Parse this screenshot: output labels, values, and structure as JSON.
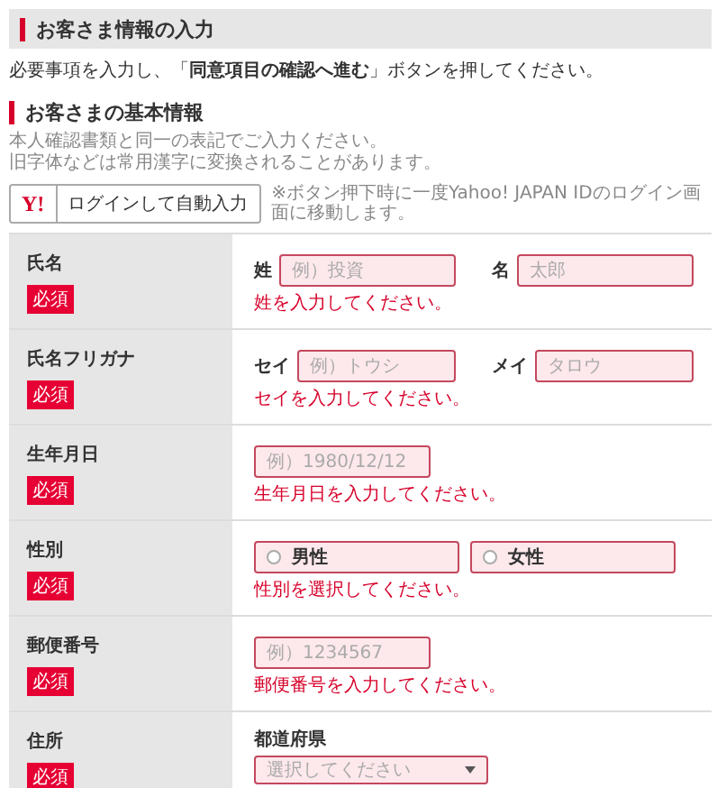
{
  "header": {
    "title": "お客さま情報の入力"
  },
  "intro": "必要事項を入力し、「**同意項目の確認へ進む**」ボタンを押してください。",
  "section": {
    "title": "お客さまの基本情報",
    "notes": [
      "本人確認書類と同一の表記でご入力ください。",
      "旧字体などは常用漢字に変換されることがあります。"
    ]
  },
  "login": {
    "logo": "Y!",
    "label": "ログインして自動入力",
    "note": "※ボタン押下時に一度Yahoo! JAPAN IDのログイン画面に移動します。"
  },
  "rows": [
    {
      "label": "氏名",
      "badge": "必須",
      "kind": "pair",
      "fields": [
        {
          "label": "姓",
          "placeholder": "例）投資",
          "invalid": true
        },
        {
          "label": "名",
          "placeholder": "太郎",
          "invalid": true
        }
      ],
      "error": "姓を入力してください。"
    },
    {
      "label": "氏名フリガナ",
      "badge": "必須",
      "kind": "pair",
      "fields": [
        {
          "label": "セイ",
          "placeholder": "例）トウシ",
          "invalid": true
        },
        {
          "label": "メイ",
          "placeholder": "タロウ",
          "invalid": true
        }
      ],
      "error": "セイを入力してください。"
    },
    {
      "label": "生年月日",
      "badge": "必須",
      "kind": "text",
      "field": {
        "placeholder": "例）1980/12/12",
        "invalid": true
      },
      "error": "生年月日を入力してください。"
    },
    {
      "label": "性別",
      "badge": "必須",
      "kind": "radio",
      "invalid": true,
      "options": [
        {
          "label": "男性",
          "selected": false
        },
        {
          "label": "女性",
          "selected": false
        }
      ],
      "error": "性別を選択してください。"
    },
    {
      "label": "郵便番号",
      "badge": "必須",
      "kind": "text",
      "field": {
        "placeholder": "例）1234567",
        "invalid": true
      },
      "error": "郵便番号を入力してください。"
    },
    {
      "label": "住所",
      "badge": "必須",
      "kind": "select",
      "sublabel": "都道府県",
      "field": {
        "placeholder": "選択してください",
        "invalid": true
      }
    }
  ]
}
